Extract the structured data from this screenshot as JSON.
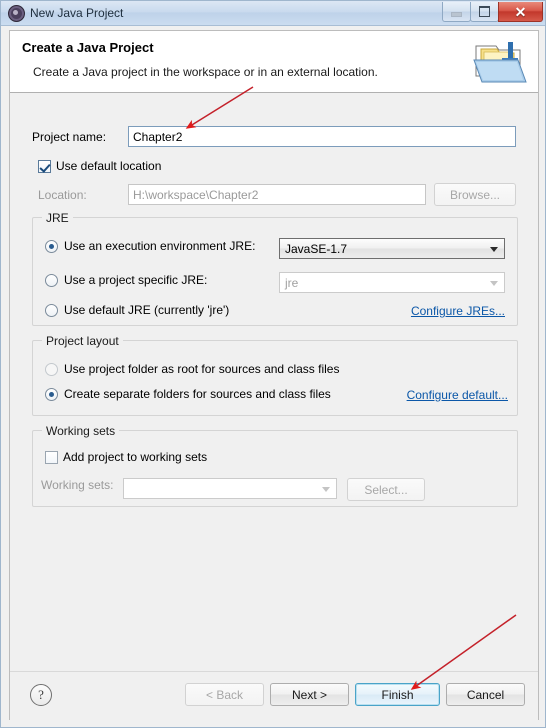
{
  "window": {
    "title": "New Java Project",
    "title_icon": "eclipse-wizard-icon",
    "controls": {
      "minimize": "minimize-icon",
      "maximize": "restore-icon",
      "close": "✕"
    }
  },
  "header": {
    "title": "Create a Java Project",
    "subtitle": "Create a Java project in the workspace or in an external location.",
    "banner_icon": "java-project-folder-icon"
  },
  "form": {
    "project_name_label": "Project name:",
    "project_name_value": "Chapter2",
    "project_name_placeholder": "",
    "use_default_location_label": "Use default location",
    "use_default_location_checked": true,
    "location_label": "Location:",
    "location_value": "H:\\workspace\\Chapter2",
    "browse_label": "Browse..."
  },
  "jre": {
    "group_title": "JRE",
    "option_execution_env_label": "Use an execution environment JRE:",
    "option_execution_env_selected": true,
    "execution_env_value": "JavaSE-1.7",
    "option_project_specific_label": "Use a project specific JRE:",
    "option_project_specific_selected": false,
    "project_specific_value": "jre",
    "option_default_jre_label": "Use default JRE (currently 'jre')",
    "option_default_jre_selected": false,
    "configure_link": "Configure JREs..."
  },
  "layout": {
    "group_title": "Project layout",
    "option_root_label": "Use project folder as root for sources and class files",
    "option_root_selected": false,
    "option_separate_label": "Create separate folders for sources and class files",
    "option_separate_selected": true,
    "configure_link": "Configure default..."
  },
  "working_sets": {
    "group_title": "Working sets",
    "add_checkbox_label": "Add project to working sets",
    "add_checkbox_checked": false,
    "working_sets_label": "Working sets:",
    "working_sets_value": "",
    "select_label": "Select..."
  },
  "footer": {
    "help_icon": "?",
    "back_label": "< Back",
    "back_enabled": false,
    "next_label": "Next >",
    "next_enabled": true,
    "finish_label": "Finish",
    "finish_focused": true,
    "cancel_label": "Cancel"
  },
  "annotations": {
    "arrow_color": "#e01b1b",
    "arrow_project_name": "points to project name field",
    "arrow_finish": "points to finish button"
  }
}
